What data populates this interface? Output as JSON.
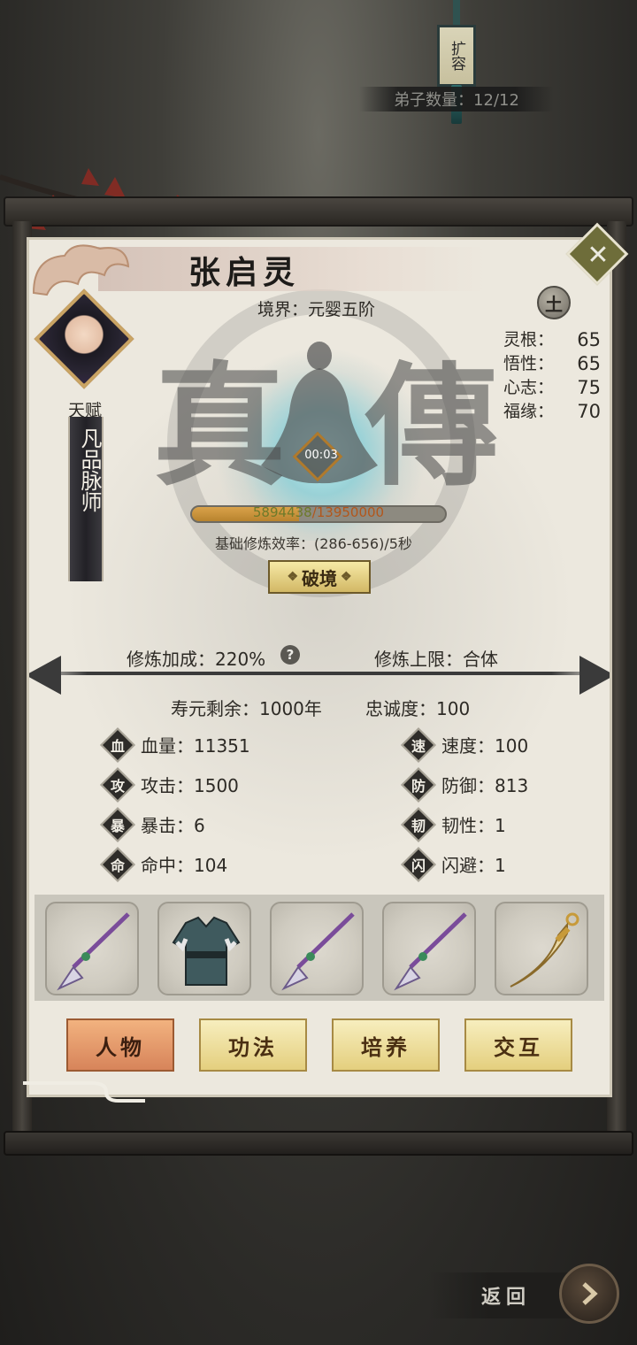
{
  "top": {
    "expand_label": "扩容",
    "disciple_count": "弟子数量：12/12"
  },
  "character": {
    "name": "张启灵",
    "realm": "境界：元婴五阶",
    "talent_label": "天赋",
    "talent_value": "凡品脉师",
    "element": "土",
    "attributes": [
      {
        "label": "灵根：",
        "value": "65"
      },
      {
        "label": "悟性：",
        "value": "65"
      },
      {
        "label": "心志：",
        "value": "75"
      },
      {
        "label": "福缘：",
        "value": "70"
      }
    ],
    "banner_left": "真",
    "banner_right": "傳",
    "timer": "00:03"
  },
  "cultivation": {
    "exp_current": "5894438",
    "exp_max": "/13950000",
    "exp_ratio": 0.4225,
    "rate": "基础修炼效率：(286-656)/5秒",
    "breakthrough_label": "破境",
    "bonus": "修炼加成：220%",
    "help_symbol": "?",
    "limit": "修炼上限：合体"
  },
  "stats": {
    "lifespan": "寿元剩余：1000年",
    "loyalty": "忠诚度：100",
    "left": [
      {
        "icon": "血",
        "label": "血量：11351"
      },
      {
        "icon": "攻",
        "label": "攻击：1500"
      },
      {
        "icon": "暴",
        "label": "暴击：6"
      },
      {
        "icon": "命",
        "label": "命中：104"
      }
    ],
    "right": [
      {
        "icon": "速",
        "label": "速度：100"
      },
      {
        "icon": "防",
        "label": "防御：813"
      },
      {
        "icon": "韧",
        "label": "韧性：1"
      },
      {
        "icon": "闪",
        "label": "闪避：1"
      }
    ]
  },
  "equipment": [
    "spear-icon",
    "robe-icon",
    "spear-icon",
    "spear-icon",
    "saber-icon"
  ],
  "tabs": [
    {
      "label": "人物",
      "active": true
    },
    {
      "label": "功法",
      "active": false
    },
    {
      "label": "培养",
      "active": false
    },
    {
      "label": "交互",
      "active": false
    }
  ],
  "footer": {
    "back_label": "返回"
  },
  "colors": {
    "panel": "#ece8de",
    "gold": "#d9a24a",
    "active_tab": "#d7845a"
  }
}
